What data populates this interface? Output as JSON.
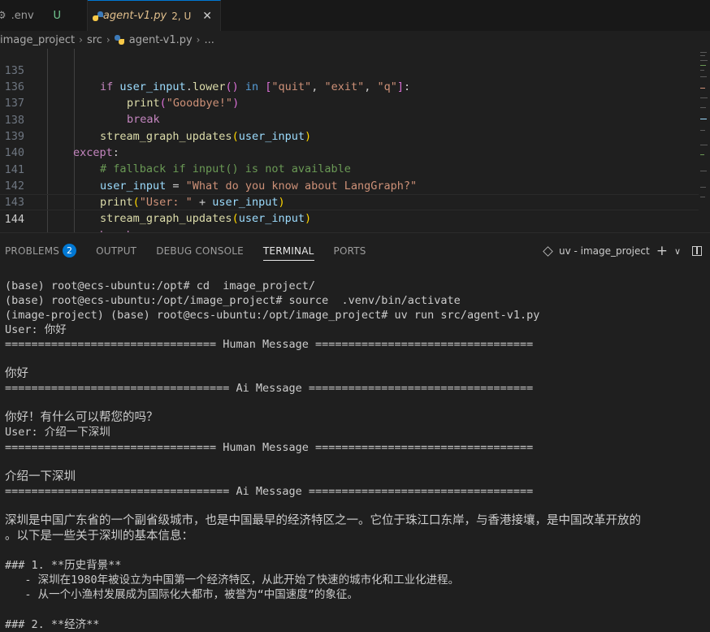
{
  "tabs": [
    {
      "icon": "gear-icon",
      "label": ".env",
      "status": "U"
    },
    {
      "icon": "python-file-icon",
      "label": "agent-v1.py",
      "status": "2, U",
      "close": "✕"
    }
  ],
  "breadcrumb": [
    "image_project",
    "src",
    "agent-v1.py",
    "..."
  ],
  "editor": {
    "lines": [
      {
        "num": "135"
      },
      {
        "num": "136"
      },
      {
        "num": "137"
      },
      {
        "num": "138"
      },
      {
        "num": "139"
      },
      {
        "num": "140"
      },
      {
        "num": "141"
      },
      {
        "num": "142"
      },
      {
        "num": "143"
      },
      {
        "num": "144"
      }
    ],
    "code": {
      "l135": {
        "kw_if": "if",
        "var": "user_input",
        "dot": ".",
        "fn": "lower",
        "paren": "()",
        "kw_in": "in",
        "open": "[",
        "s1": "\"quit\"",
        "c1": ", ",
        "s2": "\"exit\"",
        "c2": ", ",
        "s3": "\"q\"",
        "close": "]",
        "colon": ":"
      },
      "l136": {
        "fn": "print",
        "open": "(",
        "str": "\"Goodbye!\"",
        "close": ")"
      },
      "l137": {
        "kw": "break"
      },
      "l138": {
        "fn": "stream_graph_updates",
        "open": "(",
        "var": "user_input",
        "close": ")"
      },
      "l139": {
        "kw": "except",
        "colon": ":"
      },
      "l140": {
        "comment": "# fallback if input() is not available"
      },
      "l141": {
        "var": "user_input",
        "eq": " = ",
        "str": "\"What do you know about LangGraph?\""
      },
      "l142": {
        "fn": "print",
        "open": "(",
        "str": "\"User: \"",
        "plus": " + ",
        "var": "user_input",
        "close": ")"
      },
      "l143": {
        "fn": "stream_graph_updates",
        "open": "(",
        "var": "user_input",
        "close": ")"
      },
      "l144": {
        "kw": "break"
      }
    }
  },
  "panel": {
    "tabs": [
      {
        "label": "PROBLEMS",
        "badge": "2"
      },
      {
        "label": "OUTPUT"
      },
      {
        "label": "DEBUG CONSOLE"
      },
      {
        "label": "TERMINAL",
        "active": true
      },
      {
        "label": "PORTS"
      }
    ],
    "terminal_name": "uv - image_project",
    "add_symbol": "+",
    "dropdown_symbol": "∨"
  },
  "terminal": {
    "lines": [
      "(base) root@ecs-ubuntu:/opt# cd  image_project/",
      "(base) root@ecs-ubuntu:/opt/image_project# source  .venv/bin/activate",
      "(image-project) (base) root@ecs-ubuntu:/opt/image_project# uv run src/agent-v1.py",
      "User: 你好",
      "================================ Human Message =================================",
      "你好",
      "================================== Ai Message ==================================",
      "你好！有什么可以帮您的吗？",
      "User: 介绍一下深圳",
      "================================ Human Message =================================",
      "介绍一下深圳",
      "================================== Ai Message ==================================",
      "深圳是中国广东省的一个副省级城市，也是中国最早的经济特区之一。它位于珠江口东岸，与香港接壤，是中国改革开放的",
      "。以下是一些关于深圳的基本信息：",
      "### 1. **历史背景**",
      "   - 深圳在1980年被设立为中国第一个经济特区，从此开始了快速的城市化和工业化进程。",
      "   - 从一个小渔村发展成为国际化大都市，被誉为“中国速度”的象征。",
      "### 2. **经济**"
    ]
  }
}
